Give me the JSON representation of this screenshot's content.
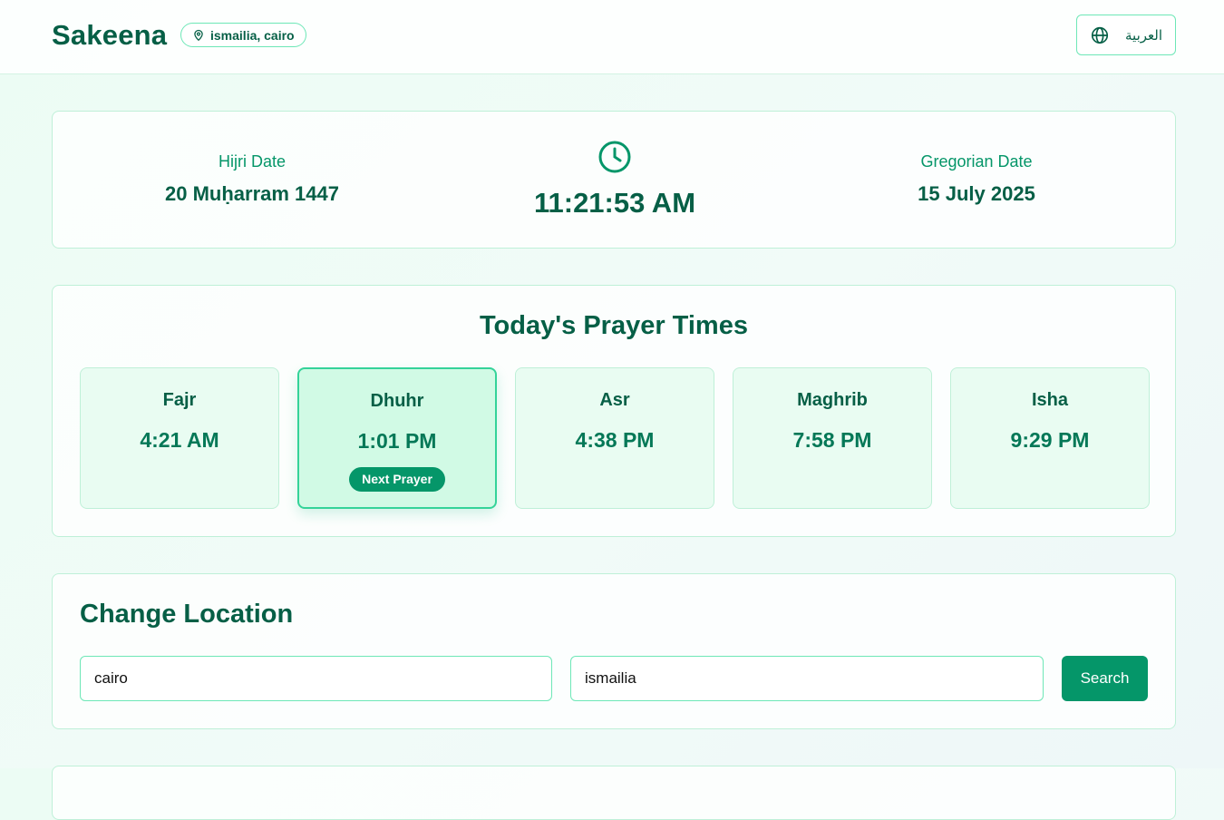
{
  "header": {
    "brand": "Sakeena",
    "location_badge": "ismailia, cairo",
    "language_button": "العربية"
  },
  "dates": {
    "hijri_label": "Hijri Date",
    "hijri_value": "20 Muḥarram 1447",
    "current_time": "11:21:53 AM",
    "gregorian_label": "Gregorian Date",
    "gregorian_value": "15 July 2025"
  },
  "prayer_times": {
    "title": "Today's Prayer Times",
    "next_badge": "Next Prayer",
    "items": [
      {
        "name": "Fajr",
        "time": "4:21 AM"
      },
      {
        "name": "Dhuhr",
        "time": "1:01 PM"
      },
      {
        "name": "Asr",
        "time": "4:38 PM"
      },
      {
        "name": "Maghrib",
        "time": "7:58 PM"
      },
      {
        "name": "Isha",
        "time": "9:29 PM"
      }
    ]
  },
  "change_location": {
    "title": "Change Location",
    "city_value": "cairo",
    "country_value": "ismailia",
    "search_label": "Search"
  },
  "colors": {
    "primary": "#059669",
    "dark_text": "#065f46",
    "card_bg": "#e9fcf2",
    "highlight_bg": "#d1fae5",
    "border": "#6ee7b7"
  },
  "icons": {
    "location": "map-pin-icon",
    "language": "globe-icon",
    "clock": "clock-icon"
  }
}
